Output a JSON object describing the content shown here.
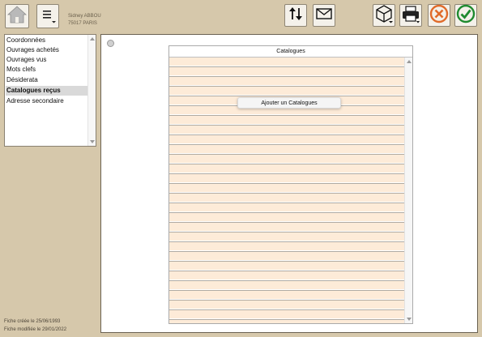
{
  "header": {
    "user_name": "Sidney ABBOU",
    "user_city": "75017 PARIS"
  },
  "toolbar": {
    "icons": [
      "home-icon",
      "menu-icon",
      "sort-icon",
      "mail-icon",
      "box-icon",
      "printer-icon",
      "cancel-icon",
      "confirm-icon"
    ],
    "cancel_color": "#e06b2a",
    "confirm_color": "#1f8a2f"
  },
  "sidebar": {
    "items": [
      {
        "label": "Coordonnées",
        "selected": false
      },
      {
        "label": "Ouvrages achetés",
        "selected": false
      },
      {
        "label": "Ouvrages vus",
        "selected": false
      },
      {
        "label": "Mots clefs",
        "selected": false
      },
      {
        "label": "Désiderata",
        "selected": false
      },
      {
        "label": "Catalogues reçus",
        "selected": true
      },
      {
        "label": "Adresse secondaire",
        "selected": false
      }
    ]
  },
  "footer": {
    "created": "Fiche créée le 25/06/1993",
    "modified": "Fiche modifiée le 29/01/2022"
  },
  "main": {
    "table_header": "Catalogues",
    "context_menu_item": "Ajouter un Catalogues",
    "row_color": "#fdebd8"
  }
}
